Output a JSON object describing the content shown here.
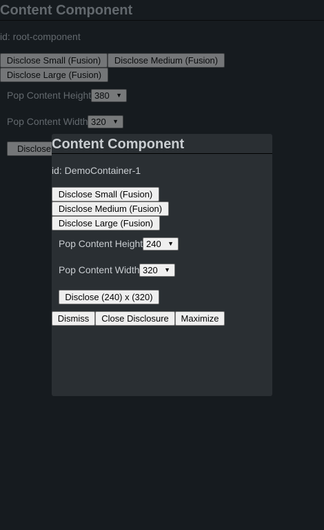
{
  "root": {
    "title": "Content Component",
    "id_text": "id: root-component",
    "buttons": {
      "disclose_small": "Disclose Small (Fusion)",
      "disclose_medium": "Disclose Medium (Fusion)",
      "disclose_large": "Disclose Large (Fusion)"
    },
    "height_label": "Pop Content Height",
    "height_value": "380",
    "width_label": "Pop Content Width",
    "width_value": "320",
    "disclose_label": "Disclose ("
  },
  "popup": {
    "title": "Content Component",
    "id_text": "id: DemoContainer-1",
    "buttons": {
      "disclose_small": "Disclose Small (Fusion)",
      "disclose_medium": "Disclose Medium (Fusion)",
      "disclose_large": "Disclose Large (Fusion)"
    },
    "height_label": "Pop Content Height",
    "height_value": "240",
    "width_label": "Pop Content Width",
    "width_value": "320",
    "disclose_label": "Disclose (240) x (320)",
    "dismiss_label": "Dismiss",
    "close_disclosure_label": "Close Disclosure",
    "maximize_label": "Maximize"
  }
}
